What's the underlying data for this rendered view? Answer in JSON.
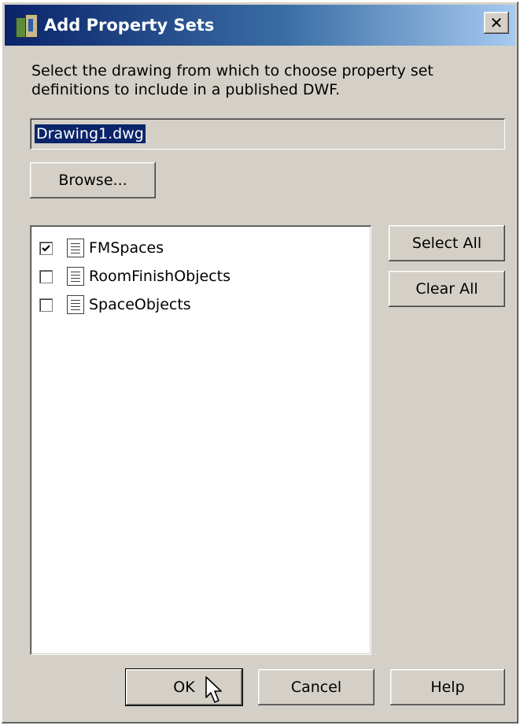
{
  "window": {
    "title": "Add Property Sets",
    "close_label": "✕"
  },
  "description": "Select the drawing from which to choose property set definitions to include in a published DWF.",
  "drawing_field": {
    "value": "Drawing1.dwg"
  },
  "browse_label": "Browse...",
  "property_sets": [
    {
      "label": "FMSpaces",
      "checked": true
    },
    {
      "label": "RoomFinishObjects",
      "checked": false
    },
    {
      "label": "SpaceObjects",
      "checked": false
    }
  ],
  "side_buttons": {
    "select_all": "Select All",
    "clear_all": "Clear All"
  },
  "footer_buttons": {
    "ok": "OK",
    "cancel": "Cancel",
    "help": "Help"
  },
  "icons": [
    "app-icon",
    "close-icon",
    "checkbox-icon",
    "document-icon",
    "mouse-cursor-icon"
  ]
}
